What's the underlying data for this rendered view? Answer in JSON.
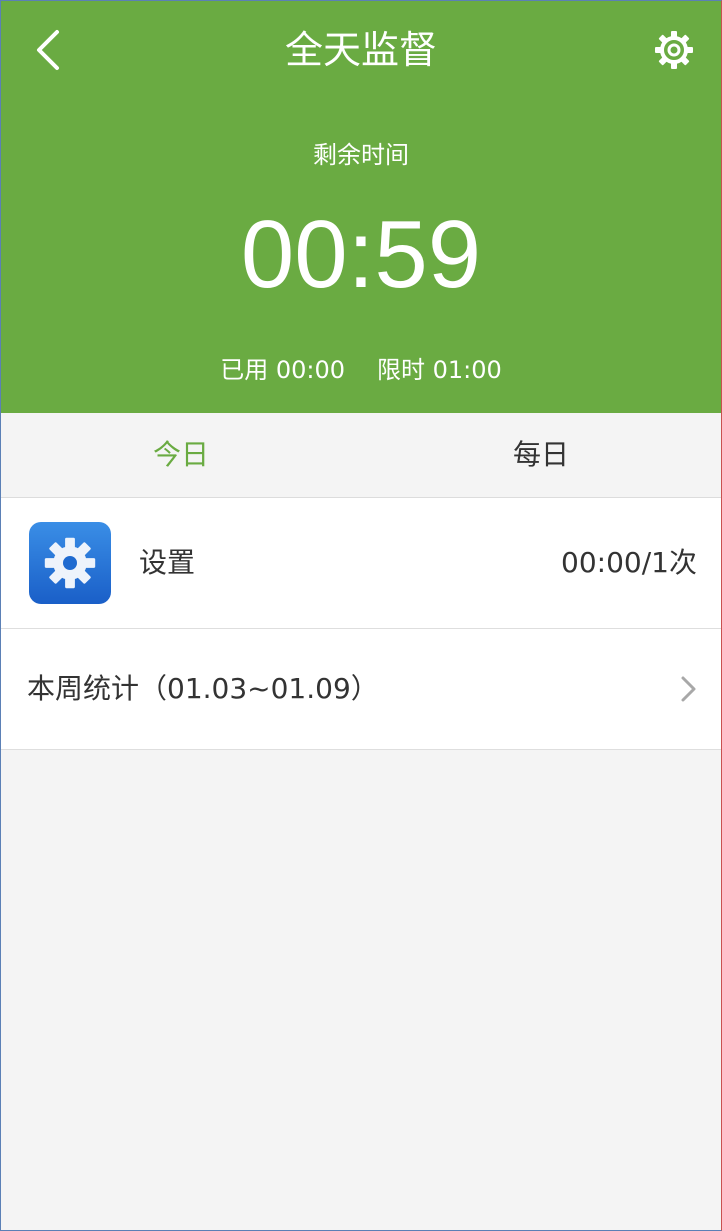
{
  "header": {
    "title": "全天监督",
    "remain_label": "剩余时间",
    "remain_time": "00:59",
    "used_label": "已用 00:00",
    "limit_label": "限时 01:00"
  },
  "tabs": [
    {
      "label": "今日",
      "active": true
    },
    {
      "label": "每日",
      "active": false
    }
  ],
  "apps": [
    {
      "name": "设置",
      "usage": "00:00/1次",
      "icon": "settings-gear-icon"
    }
  ],
  "week": {
    "label": "本周统计（01.03~01.09）"
  },
  "colors": {
    "accent": "#6aab42",
    "background": "#f4f4f4",
    "text": "#333333"
  }
}
